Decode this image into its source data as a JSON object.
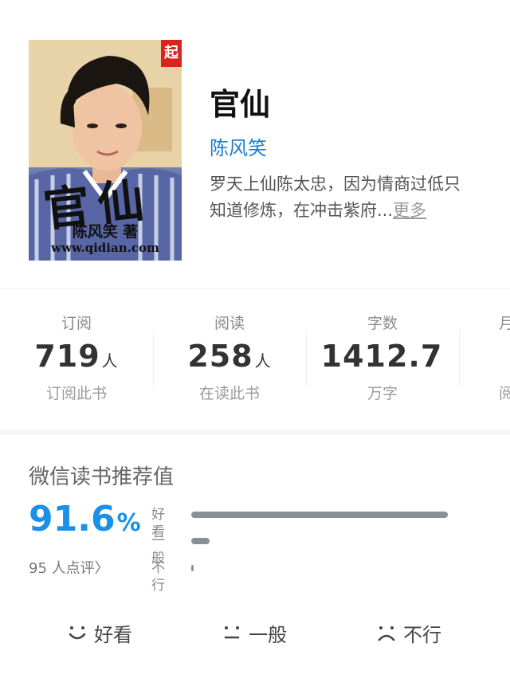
{
  "book": {
    "title": "官仙",
    "author": "陈风笑",
    "intro": "罗天上仙陈太忠，因为情商过低只知道修炼，在冲击紫府...",
    "more_label": "更多",
    "cover": {
      "title_text": "官仙",
      "author_text": "陈风笑 著",
      "url_text": "www.qidian.com",
      "badge_text": "起"
    }
  },
  "stats": [
    {
      "label": "订阅",
      "value": "719",
      "unit": "人",
      "sub": "订阅此书"
    },
    {
      "label": "阅读",
      "value": "258",
      "unit": "人",
      "sub": "在读此书"
    },
    {
      "label": "字数",
      "value": "1412.7",
      "unit": "",
      "sub": "万字"
    },
    {
      "label": "月",
      "value": "",
      "unit": "",
      "sub": "阅"
    }
  ],
  "recommend": {
    "title": "微信读书推荐值",
    "score": "91.6",
    "pct_sign": "%",
    "count": "95 人点评",
    "count_arrow": "〉",
    "bars": [
      {
        "label": "好看",
        "fraction": 1.0
      },
      {
        "label": "一般",
        "fraction": 0.07
      },
      {
        "label": "不行",
        "fraction": 0.01
      }
    ]
  },
  "rating_buttons": [
    {
      "label": "好看",
      "icon": "smile-icon"
    },
    {
      "label": "一般",
      "icon": "neutral-face-icon"
    },
    {
      "label": "不行",
      "icon": "frown-icon"
    }
  ],
  "colors": {
    "accent": "#1c8fe6",
    "author": "#1f7ccd",
    "bar": "#8a9099"
  }
}
